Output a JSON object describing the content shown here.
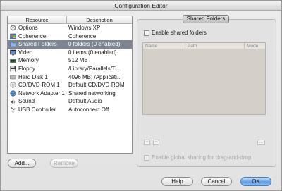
{
  "window": {
    "title": "Configuration Editor"
  },
  "table": {
    "headers": [
      "Resource",
      "Description"
    ],
    "rows": [
      {
        "icon": "options-icon",
        "resource": "Options",
        "description": "Windows XP",
        "selected": false
      },
      {
        "icon": "coherence-icon",
        "resource": "Coherence",
        "description": "Coherence",
        "selected": false
      },
      {
        "icon": "shared-folder-icon",
        "resource": "Shared Folders",
        "description": "0 folders (0 enabled)",
        "selected": true
      },
      {
        "icon": "video-icon",
        "resource": "Video",
        "description": "0 items (0 enabled)",
        "selected": false
      },
      {
        "icon": "memory-icon",
        "resource": "Memory",
        "description": "512 MB",
        "selected": false
      },
      {
        "icon": "floppy-icon",
        "resource": "Floppy",
        "description": "/Library/Parallels/T...",
        "selected": false
      },
      {
        "icon": "hard-disk-icon",
        "resource": "Hard Disk 1",
        "description": "4096 MB; /Applicati...",
        "selected": false
      },
      {
        "icon": "cd-dvd-icon",
        "resource": "CD/DVD-ROM 1",
        "description": "Default CD/DVD-ROM",
        "selected": false
      },
      {
        "icon": "network-adapter-icon",
        "resource": "Network Adapter 1",
        "description": "Shared networking",
        "selected": false
      },
      {
        "icon": "sound-icon",
        "resource": "Sound",
        "description": "Default Audio",
        "selected": false
      },
      {
        "icon": "usb-icon",
        "resource": "USB Controller",
        "description": "Autoconnect Off",
        "selected": false
      }
    ]
  },
  "left_buttons": {
    "add": "Add...",
    "remove": "Remove"
  },
  "panel": {
    "tab": "Shared Folders",
    "enable_shared": "Enable shared folders",
    "columns": [
      "Name",
      "Path",
      "Mode"
    ],
    "add_symbol": "+",
    "remove_symbol": "−",
    "more_symbol": "...",
    "enable_global": "Enable global sharing for drag-and-drop"
  },
  "footer": {
    "help": "Help",
    "cancel": "Cancel",
    "ok": "OK"
  },
  "colors": {
    "selection": "#7d8592",
    "accent": "#5d9fe5"
  }
}
